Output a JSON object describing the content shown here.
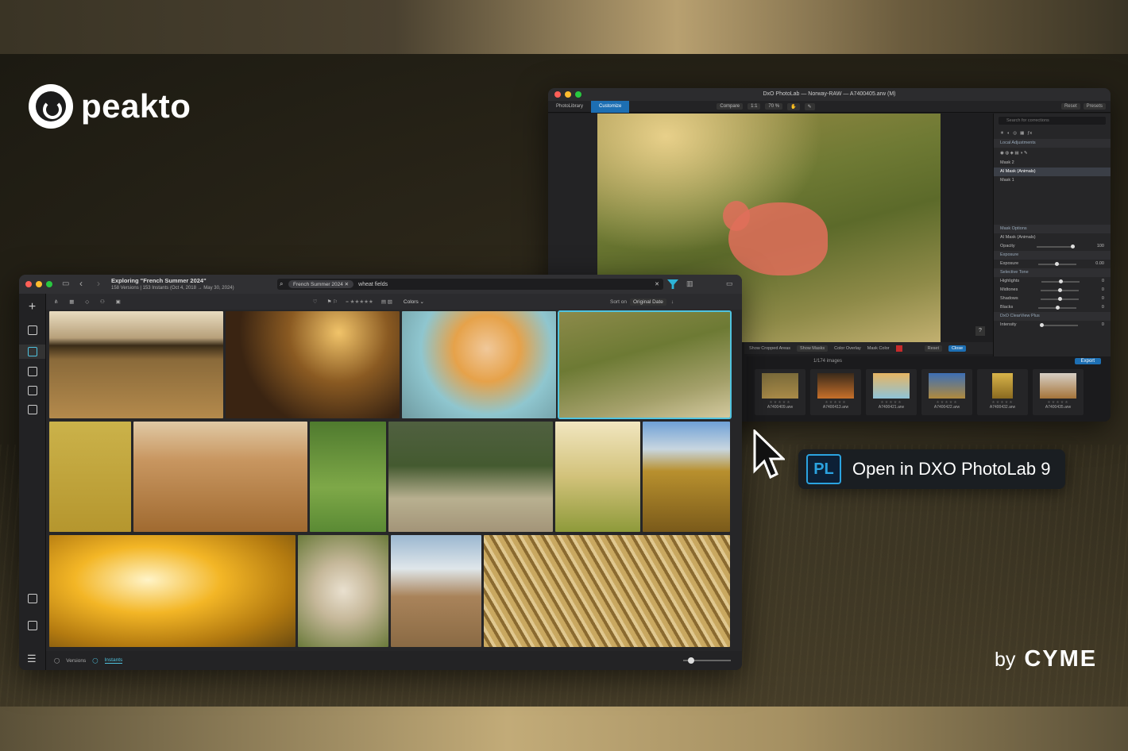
{
  "brand": {
    "name": "peakto",
    "by_label": "by",
    "by_company": "CYME"
  },
  "callout": {
    "badge": "PL",
    "text": "Open  in DXO PhotoLab 9"
  },
  "dxo": {
    "title": "DxO PhotoLab — Norway-RAW — A7400405.arw (M)",
    "tabs": [
      "PhotoLibrary",
      "Customize"
    ],
    "toolbar": {
      "compare": "Compare",
      "zoom_fit": "1:1",
      "zoom": "70 %",
      "reset": "Reset",
      "presets": "Presets"
    },
    "panel": {
      "search_placeholder": "Search for corrections",
      "local_adjustments": "Local Adjustments",
      "mask2": "Mask 2",
      "ai_mask": "AI Mask (Animals)",
      "mask1": "Mask 1",
      "mask_options": "Mask Options",
      "ai_mask_option": "AI Mask (Animals)",
      "opacity": {
        "label": "Opacity",
        "value": "100"
      },
      "exposure_section": "Exposure",
      "exposure": {
        "label": "Exposure",
        "value": "0.00"
      },
      "selective_tone": "Selective Tone",
      "highlights": {
        "label": "Highlights",
        "value": "0"
      },
      "midtones": {
        "label": "Midtones",
        "value": "0"
      },
      "shadows": {
        "label": "Shadows",
        "value": "0"
      },
      "blacks": {
        "label": "Blacks",
        "value": "0"
      },
      "clearview": "DxO ClearView Plus",
      "intensity": {
        "label": "Intensity",
        "value": "0"
      }
    },
    "slider_levels": {
      "opacity": 1.0,
      "exposure": 0.5,
      "highlights": 0.5,
      "midtones": 0.5,
      "shadows": 0.5,
      "blacks": 0.5,
      "intensity": 0.0
    },
    "mask_bar": {
      "show_cropped": "Show Cropped Areas",
      "show_masks": "Show Masks",
      "color_overlay": "Color Overlay",
      "mask_color": "Mask Color",
      "reset": "Reset",
      "close": "Close"
    },
    "filmstrip": {
      "count": "1/174 images",
      "export": "Export",
      "files": [
        "A7400409.arw",
        "A7400413.arw",
        "A7400421.arw",
        "A7400422.arw",
        "A7400432.arw",
        "A7400435.arw"
      ]
    },
    "help": "?"
  },
  "peakto": {
    "explore_title": "Exploring \"French Summer 2024\"",
    "explore_meta": "158 Versions | 153 Instants (Oct 4, 2018 → May 30, 2024)",
    "search_chip": "French Summer 2024",
    "search_query": "wheat fields",
    "toolbar": {
      "colors": "Colors",
      "sort_label": "Sort on",
      "sort_value": "Original Date"
    },
    "bottom": {
      "versions": "Versions",
      "instants": "Instants"
    }
  },
  "colors": {
    "accent": "#4fc3e0",
    "dxo_blue": "#1d6fb3",
    "mask": "#e16e5a"
  }
}
